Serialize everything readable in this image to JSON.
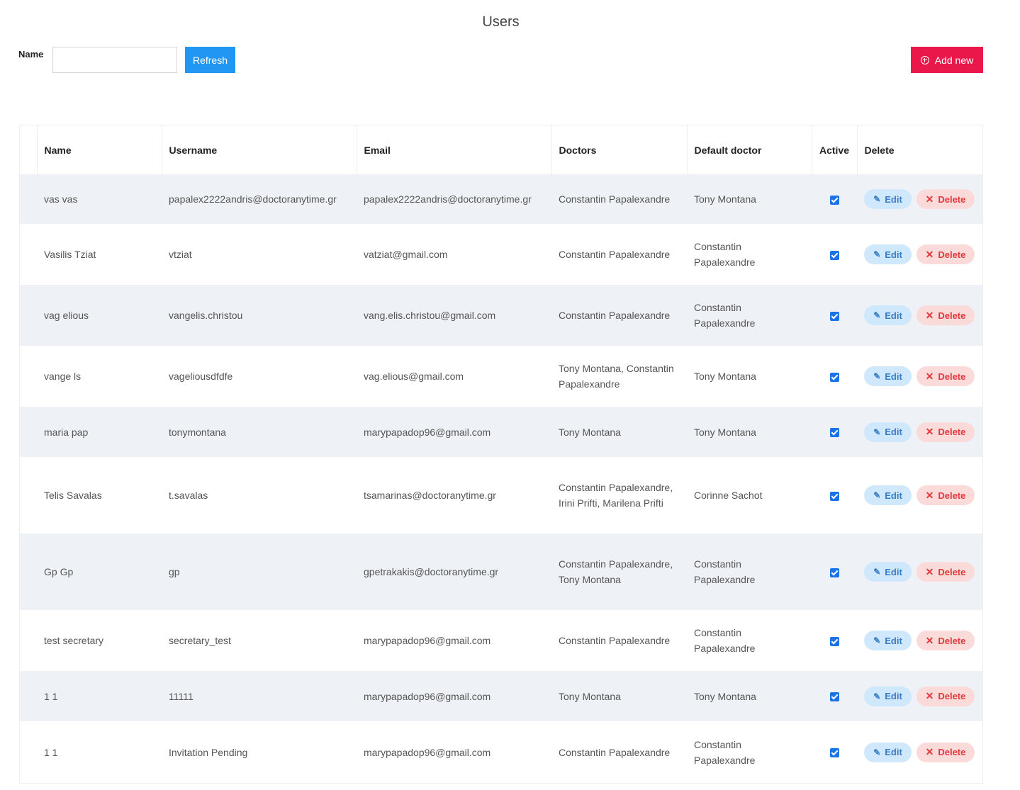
{
  "page": {
    "title": "Users"
  },
  "filter": {
    "name_label": "Name",
    "name_value": "",
    "refresh_label": "Refresh"
  },
  "toolbar": {
    "add_label": "Add new"
  },
  "table": {
    "headers": {
      "name": "Name",
      "username": "Username",
      "email": "Email",
      "doctors": "Doctors",
      "default_doctor": "Default doctor",
      "active": "Active",
      "delete": "Delete"
    },
    "actions": {
      "edit_label": "Edit",
      "delete_label": "Delete"
    },
    "rows": [
      {
        "name": "vas vas",
        "username": "papalex2222andris@doctoranytime.gr",
        "email": "papalex2222andris@doctoranytime.gr",
        "doctors": "Constantin Papalexandre",
        "default_doctor": "Tony Montana",
        "active": true
      },
      {
        "name": "Vasilis Tziat",
        "username": "vtziat",
        "email": "vatziat@gmail.com",
        "doctors": "Constantin Papalexandre",
        "default_doctor": "Constantin Papalexandre",
        "active": true
      },
      {
        "name": "vag elious",
        "username": "vangelis.christou",
        "email": "vang.elis.christou@gmail.com",
        "doctors": "Constantin Papalexandre",
        "default_doctor": "Constantin Papalexandre",
        "active": true
      },
      {
        "name": "vange ls",
        "username": "vageliousdfdfe",
        "email": "vag.elious@gmail.com",
        "doctors": "Tony Montana, Constantin Papalexandre",
        "default_doctor": "Tony Montana",
        "active": true
      },
      {
        "name": "maria pap",
        "username": "tonymontana",
        "email": "marypapadop96@gmail.com",
        "doctors": "Tony Montana",
        "default_doctor": "Tony Montana",
        "active": true
      },
      {
        "name": "Telis Savalas",
        "username": "t.savalas",
        "email": "tsamarinas@doctoranytime.gr",
        "doctors": "Constantin Papalexandre, Irini Prifti, Marilena Prifti",
        "default_doctor": "Corinne Sachot",
        "active": true
      },
      {
        "name": "Gp Gp",
        "username": "gp",
        "email": "gpetrakakis@doctoranytime.gr",
        "doctors": "Constantin Papalexandre, Tony Montana",
        "default_doctor": "Constantin Papalexandre",
        "active": true
      },
      {
        "name": "test secretary",
        "username": "secretary_test",
        "email": "marypapadop96@gmail.com",
        "doctors": "Constantin Papalexandre",
        "default_doctor": "Constantin Papalexandre",
        "active": true
      },
      {
        "name": "1 1",
        "username": "11111",
        "email": "marypapadop96@gmail.com",
        "doctors": "Tony Montana",
        "default_doctor": "Tony Montana",
        "active": true
      },
      {
        "name": "1 1",
        "username": "Invitation Pending",
        "email": "marypapadop96@gmail.com",
        "doctors": "Constantin Papalexandre",
        "default_doctor": "Constantin Papalexandre",
        "active": true
      }
    ]
  },
  "colors": {
    "primary": "#2196f3",
    "accent": "#e9174a",
    "stripe": "#eef1f5",
    "edit_bg": "#cfe8fb",
    "delete_bg": "#fbdada"
  },
  "icons": {
    "add": "plus-circle-icon",
    "edit": "pencil-icon",
    "delete": "x-icon",
    "active": "checkbox-checked-icon"
  }
}
